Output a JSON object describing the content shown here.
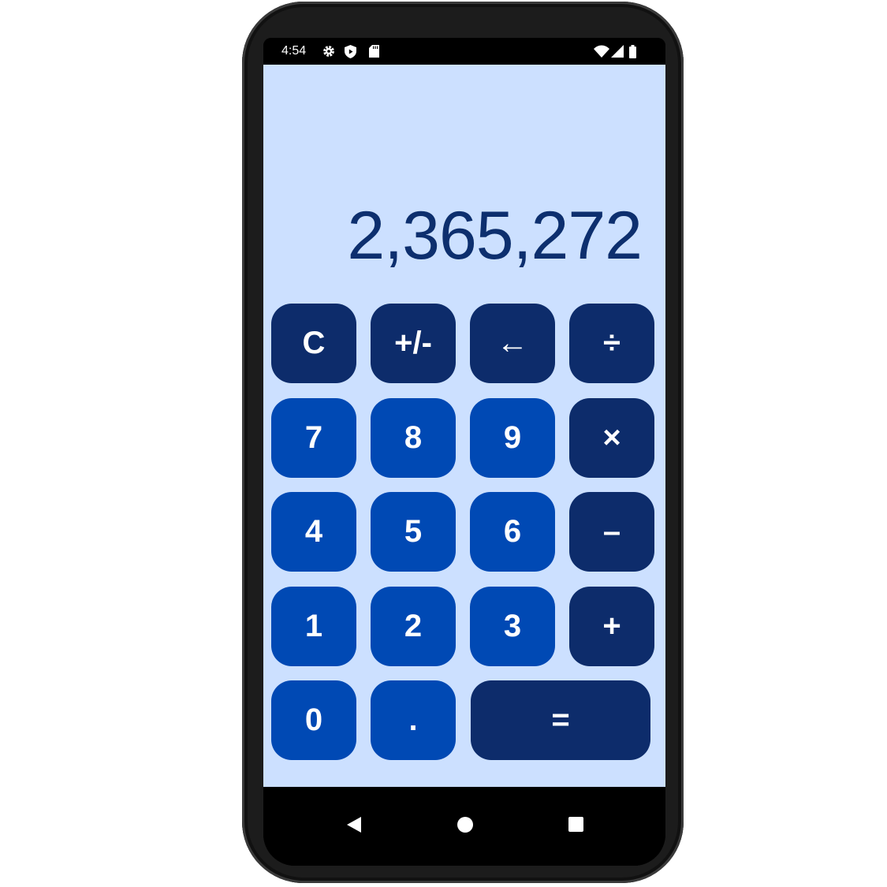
{
  "status_bar": {
    "time": "4:54",
    "left_icons": [
      "gear-icon",
      "shield-play-icon",
      "sd-card-icon"
    ],
    "right_icons": [
      "wifi-icon",
      "cell-signal-icon",
      "battery-icon"
    ]
  },
  "display": {
    "value": "2,365,272"
  },
  "keys": {
    "clear": "C",
    "sign": "+/-",
    "backspace": "←",
    "divide": "÷",
    "seven": "7",
    "eight": "8",
    "nine": "9",
    "multiply": "×",
    "four": "4",
    "five": "5",
    "six": "6",
    "subtract": "–",
    "one": "1",
    "two": "2",
    "three": "3",
    "add": "+",
    "zero": "0",
    "decimal": ".",
    "equals": "="
  },
  "colors": {
    "background": "#cce0ff",
    "display_text": "#0d2f6e",
    "operator_key": "#0d2c6b",
    "digit_key": "#0049b4",
    "key_text": "#ffffff"
  },
  "nav_bar": {
    "icons": [
      "back-icon",
      "home-icon",
      "recents-icon"
    ]
  }
}
